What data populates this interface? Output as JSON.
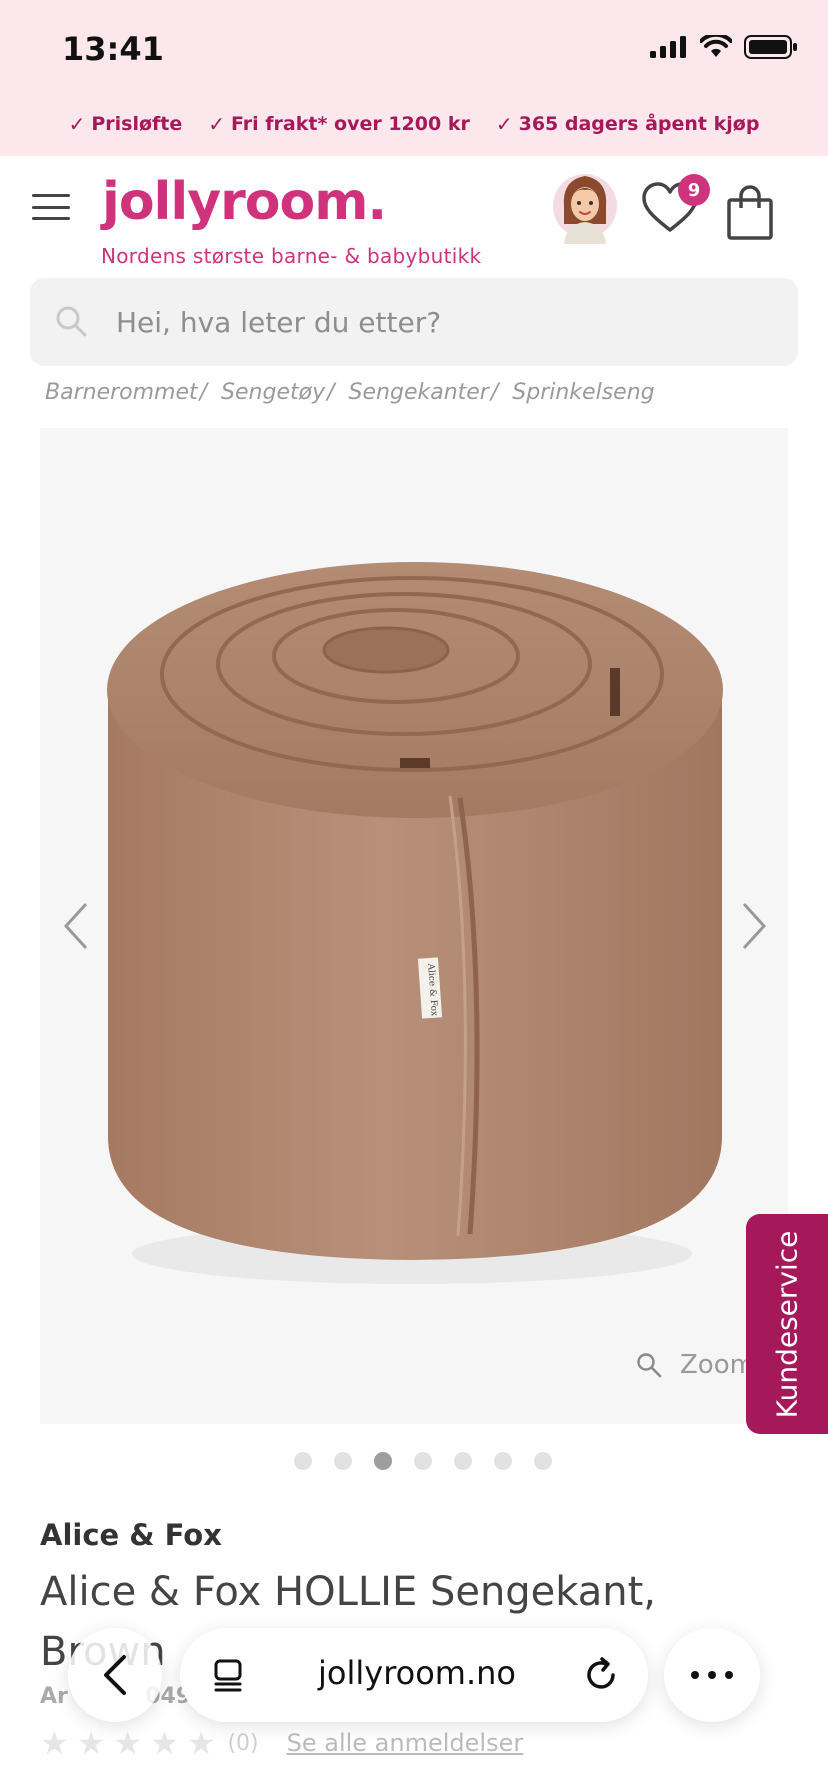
{
  "status_bar": {
    "time": "13:41"
  },
  "usp": [
    {
      "label": "Prisløfte"
    },
    {
      "label": "Fri frakt* over 1200 kr"
    },
    {
      "label": "365 dagers åpent kjøp"
    }
  ],
  "header": {
    "logo": "jollyroom.",
    "tagline": "Nordens største barne- & babybutikk",
    "wishlist_count": "9"
  },
  "search": {
    "placeholder": "Hei, hva leter du etter?"
  },
  "breadcrumb": [
    {
      "label": "Barnerommet"
    },
    {
      "label": "Sengetøy"
    },
    {
      "label": "Sengekanter"
    },
    {
      "label": "Sprinkelseng"
    }
  ],
  "gallery": {
    "zoom_label": "Zoom",
    "dot_count": 7,
    "active_index": 2,
    "product_label_text": "Alice & Fox"
  },
  "kundeservice": {
    "label": "Kundeservice"
  },
  "product": {
    "brand": "Alice & Fox",
    "title": "Alice & Fox HOLLIE Sengekant, Brown",
    "art_prefix": "Ar",
    "art_suffix": "049",
    "rating_count": "(0)",
    "reviews_link": "Se alle anmeldelser"
  },
  "browser": {
    "url": "jollyroom.no"
  },
  "colors": {
    "brand_pink": "#d0337b",
    "brand_magenta": "#a5185a",
    "band_bg": "#fce8ec"
  }
}
